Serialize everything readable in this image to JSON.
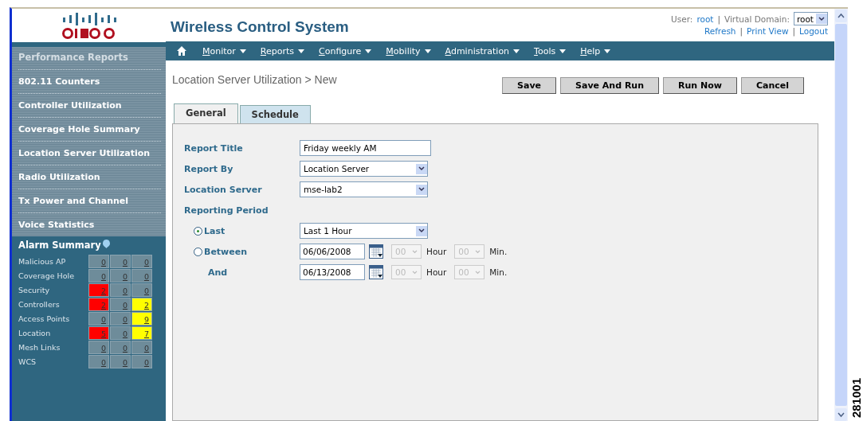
{
  "header": {
    "app_title": "Wireless Control System",
    "user_label": "User:",
    "user": "root",
    "domain_label": "Virtual Domain:",
    "domain": "root",
    "user_separator": "|",
    "links": [
      {
        "label": "Refresh"
      },
      {
        "separator": "|",
        "label": "Print View"
      },
      {
        "separator": "|",
        "label": "Logout"
      }
    ]
  },
  "nav": [
    {
      "label": "Monitor"
    },
    {
      "label": "Reports"
    },
    {
      "label": "Configure"
    },
    {
      "label": "Mobility"
    },
    {
      "label": "Administration"
    },
    {
      "label": "Tools"
    },
    {
      "label": "Help"
    }
  ],
  "sidebar": {
    "heading": "Performance Reports",
    "items": [
      {
        "label": "802.11 Counters"
      },
      {
        "label": "Controller Utilization"
      },
      {
        "label": "Coverage Hole Summary"
      },
      {
        "label": "Location Server Utilization"
      },
      {
        "label": "Radio Utilization"
      },
      {
        "label": "Tx Power and Channel"
      },
      {
        "label": "Voice Statistics"
      }
    ]
  },
  "alarm_summary": {
    "title": "Alarm Summary",
    "rows": [
      {
        "name": "Malicious AP",
        "cells": [
          {
            "value": "0",
            "color": "#6e8c9a"
          },
          {
            "value": "0",
            "color": "#6e8c9a"
          },
          {
            "value": "0",
            "color": "#6e8c9a"
          }
        ]
      },
      {
        "name": "Coverage Hole",
        "cells": [
          {
            "value": "0",
            "color": "#6e8c9a"
          },
          {
            "value": "0",
            "color": "#6e8c9a"
          },
          {
            "value": "0",
            "color": "#6e8c9a"
          }
        ]
      },
      {
        "name": "Security",
        "cells": [
          {
            "value": "2",
            "color": "#ff0000"
          },
          {
            "value": "0",
            "color": "#6e8c9a"
          },
          {
            "value": "0",
            "color": "#6e8c9a"
          }
        ]
      },
      {
        "name": "Controllers",
        "cells": [
          {
            "value": "2",
            "color": "#ff0000"
          },
          {
            "value": "0",
            "color": "#6e8c9a"
          },
          {
            "value": "2",
            "color": "#ffff00"
          }
        ]
      },
      {
        "name": "Access Points",
        "cells": [
          {
            "value": "0",
            "color": "#6e8c9a"
          },
          {
            "value": "0",
            "color": "#6e8c9a"
          },
          {
            "value": "9",
            "color": "#ffff00"
          }
        ]
      },
      {
        "name": "Location",
        "cells": [
          {
            "value": "5",
            "color": "#ff0000"
          },
          {
            "value": "0",
            "color": "#6e8c9a"
          },
          {
            "value": "7",
            "color": "#ffff00"
          }
        ]
      },
      {
        "name": "Mesh Links",
        "cells": [
          {
            "value": "0",
            "color": "#6e8c9a"
          },
          {
            "value": "0",
            "color": "#6e8c9a"
          },
          {
            "value": "0",
            "color": "#6e8c9a"
          }
        ]
      },
      {
        "name": "WCS",
        "cells": [
          {
            "value": "0",
            "color": "#6e8c9a"
          },
          {
            "value": "0",
            "color": "#6e8c9a"
          },
          {
            "value": "0",
            "color": "#6e8c9a"
          }
        ]
      }
    ]
  },
  "page_title": "Location Server Utilization > New",
  "buttons": [
    "Save",
    "Save And Run",
    "Run Now",
    "Cancel"
  ],
  "tabs": [
    {
      "label": "General",
      "selected": true
    },
    {
      "label": "Schedule",
      "selected": false
    }
  ],
  "form": {
    "report_title": {
      "label": "Report Title",
      "value": "Friday weekly AM"
    },
    "report_by": {
      "label": "Report By",
      "value": "Location Server"
    },
    "location_server": {
      "label": "Location Server",
      "value": "mse-lab2"
    },
    "reporting_period": "Reporting Period",
    "last": {
      "label": "Last",
      "selected": true,
      "value": "Last 1 Hour"
    },
    "between": {
      "label": "Between",
      "selected": false,
      "date": "06/06/2008",
      "hour": "00",
      "hour_label": "Hour",
      "min": "00",
      "min_label": "Min."
    },
    "and": {
      "label": "And",
      "date": "06/13/2008",
      "hour": "00",
      "hour_label": "Hour",
      "min": "00",
      "min_label": "Min."
    }
  },
  "figure_number": "281001"
}
